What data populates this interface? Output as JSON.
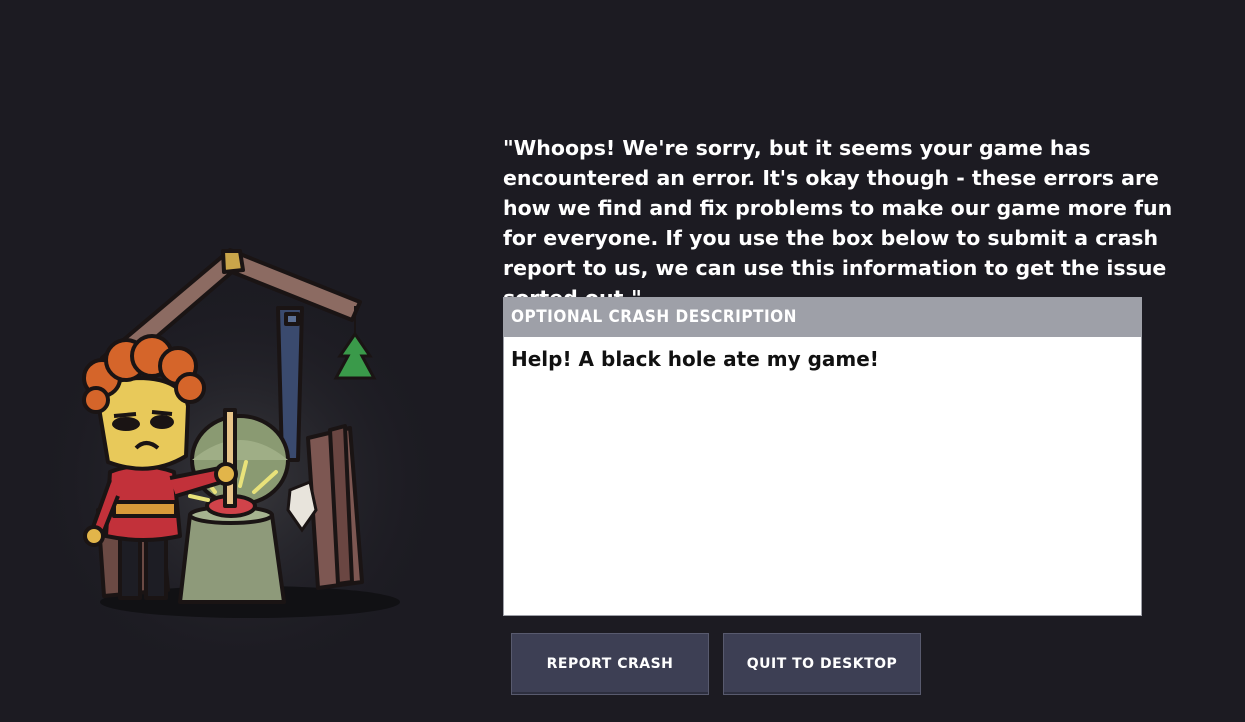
{
  "message": "\"Whoops! We're sorry, but it seems your game has encountered an error. It's okay though - these errors are how we find and fix problems to make our game more fun for everyone. If you use the box below to submit a crash report to us, we can use this information to get the issue sorted out.\"",
  "crash_form": {
    "header": "Optional Crash Description",
    "description_value": "Help! A black hole ate my game!"
  },
  "buttons": {
    "report_label": "Report Crash",
    "quit_label": "Quit to Desktop"
  },
  "colors": {
    "background": "#1c1b22",
    "panel_header": "#9ea0a8",
    "button": "#3d3f54"
  },
  "illustration": "duplicant-plunger-crash-illustration"
}
